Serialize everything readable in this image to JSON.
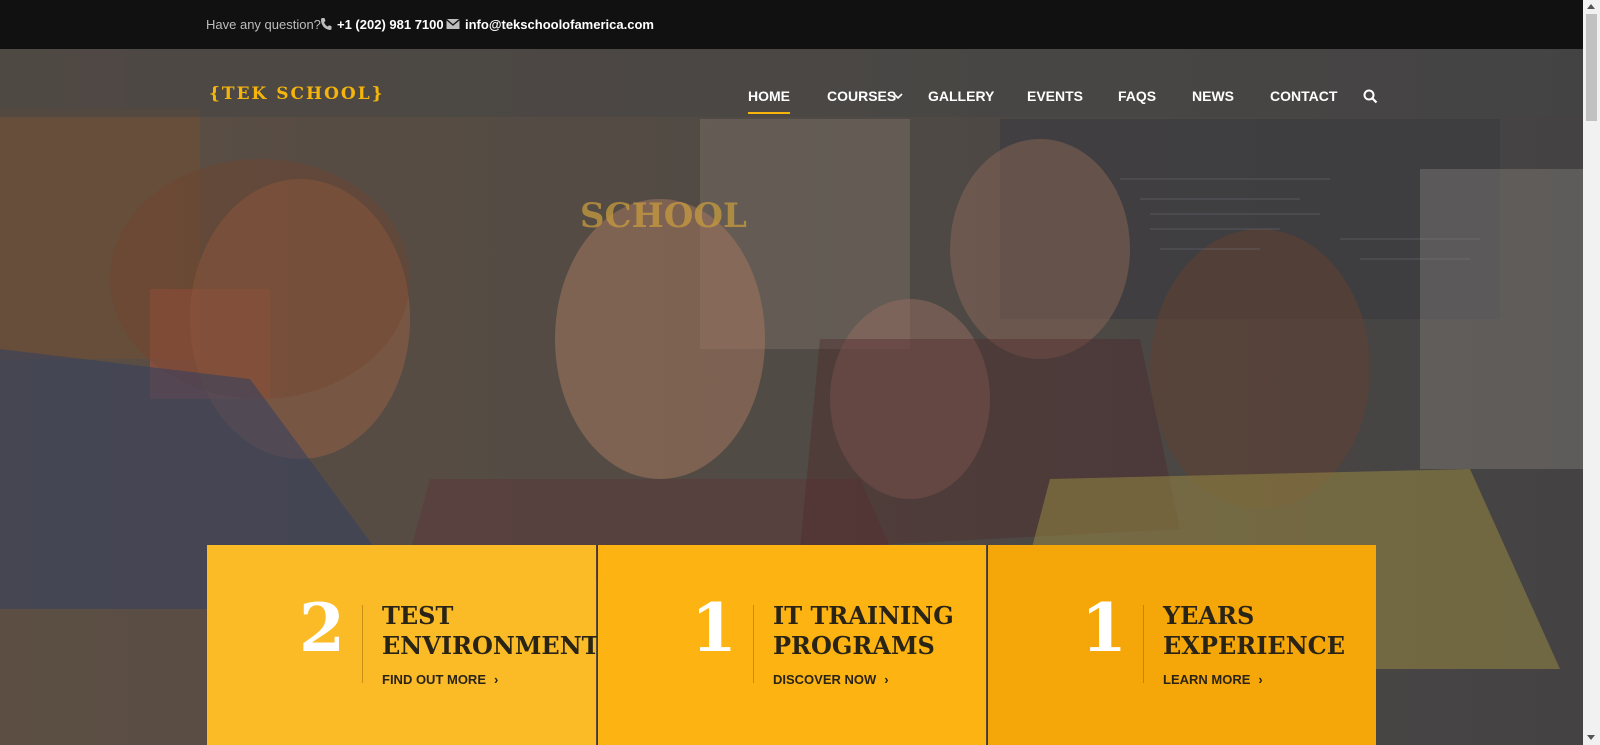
{
  "topbar": {
    "question": "Have any question?",
    "phone": "+1 (202) 981 7100",
    "email": "info@tekschoolofamerica.com",
    "phone_icon": "phone-icon",
    "email_icon": "envelope-icon"
  },
  "logo": {
    "text": "{TEK SCHOOL}"
  },
  "nav": {
    "items": [
      {
        "label": "HOME",
        "active": true
      },
      {
        "label": "COURSES",
        "has_dropdown": true
      },
      {
        "label": "GALLERY"
      },
      {
        "label": "EVENTS"
      },
      {
        "label": "FAQS"
      },
      {
        "label": "NEWS"
      },
      {
        "label": "CONTACT"
      }
    ],
    "search_icon": "search-icon"
  },
  "hero": {
    "description_note": "",
    "sign_text": "SCHOOL"
  },
  "features": [
    {
      "number": "2",
      "title_line1": "TEST",
      "title_line2": "ENVIRONMENTS",
      "link": "FIND OUT MORE"
    },
    {
      "number": "1",
      "title_line1": "IT TRAINING",
      "title_line2": "PROGRAMS",
      "link": "DISCOVER NOW"
    },
    {
      "number": "1",
      "title_line1": "YEARS",
      "title_line2": "EXPERIENCE",
      "link": "LEARN MORE"
    }
  ],
  "colors": {
    "accent": "#f5b50a",
    "topbar_bg": "#111111",
    "box1": "#fbbb27",
    "box2": "#fdb412",
    "box3": "#f5a70a"
  }
}
